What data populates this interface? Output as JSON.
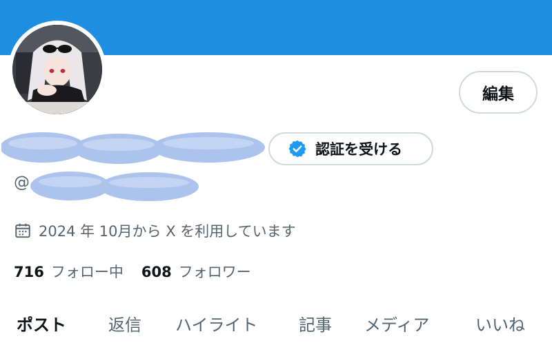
{
  "colors": {
    "banner": "#1d8ee0",
    "verified_badge": "#1d9bf0",
    "border": "#cfd9de",
    "muted": "#536471",
    "text": "#0f1419"
  },
  "profile": {
    "edit_label": "編集",
    "verify_label": "認証を受ける",
    "handle_prefix": "@",
    "joined_text": "2024 年 10月から X を利用しています",
    "avatar_icon": "anime-girl-avatar",
    "calendar_icon": "calendar-icon"
  },
  "stats": {
    "following_count": "716",
    "following_label": "フォロー中",
    "followers_count": "608",
    "followers_label": "フォロワー"
  },
  "tabs": [
    {
      "label": "ポスト",
      "active": true
    },
    {
      "label": "返信",
      "active": false
    },
    {
      "label": "ハイライト",
      "active": false
    },
    {
      "label": "記事",
      "active": false
    },
    {
      "label": "メディア",
      "active": false
    },
    {
      "label": "いいね",
      "active": false
    }
  ]
}
